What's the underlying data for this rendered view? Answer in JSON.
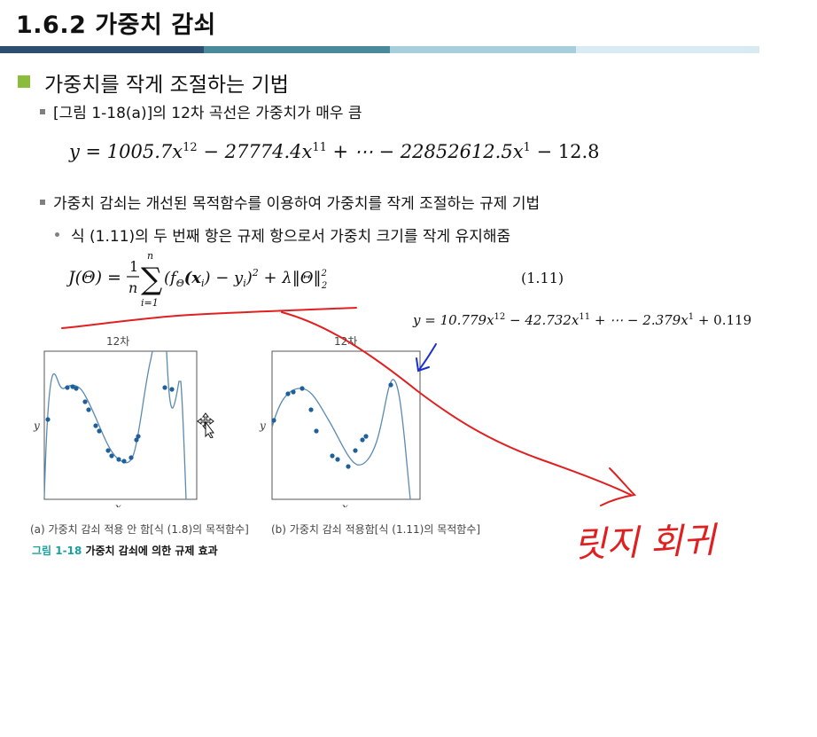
{
  "slide": {
    "title": "1.6.2 가중치 감쇠",
    "title_bar_colors": [
      "#2f4f70",
      "#4a8a9a",
      "#a7cedd",
      "#d8ebf3"
    ],
    "bullet_color": "#8cbc3c"
  },
  "content": {
    "heading": "가중치를 작게 조절하는 기법",
    "item1": "[그림 1-18(a)]의 12차 곡선은 가중치가 매우 큼",
    "equation1": {
      "prefix": "y = 1005.7x",
      "exp1": "12",
      "mid1": " − 27774.4x",
      "exp2": "11",
      "mid2": " + ⋯ − 22852612.5x",
      "exp3": "1",
      "suffix": " − 12.8"
    },
    "item2": "가중치 감쇠는 개선된 목적함수를 이용하여 가중치를 작게 조절하는 규제 기법",
    "item3": "식 (1.11)의 두 번째 항은 규제 항으로서 가중치 크기를 작게 유지해줌",
    "equation2": {
      "lhs": "J(Θ) =",
      "frac_num": "1",
      "frac_den": "n",
      "sum_top": "n",
      "sum_bottom": "i=1",
      "body": "(f",
      "sub_theta": "Θ",
      "x_part": "(x",
      "sub_i": "i",
      "minus": ") − y",
      "sub_i2": "i",
      "sq": ")",
      "sq_exp": "2",
      "reg": " + λ‖Θ‖",
      "reg_sub": "2",
      "reg_sup": "2",
      "label": "(1.11)"
    }
  },
  "figure": {
    "plot_a_title": "12차",
    "plot_b_title": "12차",
    "xlabel": "x",
    "ylabel": "y",
    "caption_a": "(a) 가중치 감쇠 적용 안 함[식 (1.8)의 목적함수]",
    "caption_b": "(b) 가중치 감쇠 적용함[식 (1.11)의 목적함수]",
    "fig_caption_num": "그림 1-18",
    "fig_caption_text": " 가중치 감쇠에 의한 규제 효과",
    "curve_color": "#5a8ab0",
    "point_color": "#1f5f9a"
  },
  "annotations": {
    "handwritten_eq": {
      "prefix": "y = 10.779x",
      "exp1": "12",
      "mid1": " − 42.732x",
      "exp2": "11",
      "mid2": " + ⋯ − 2.379x",
      "exp3": "1",
      "suffix": " + 0.119"
    },
    "handwritten_note": "릿지 회귀",
    "red_ink": "#e02020",
    "blue_ink": "#1a2fd0"
  }
}
